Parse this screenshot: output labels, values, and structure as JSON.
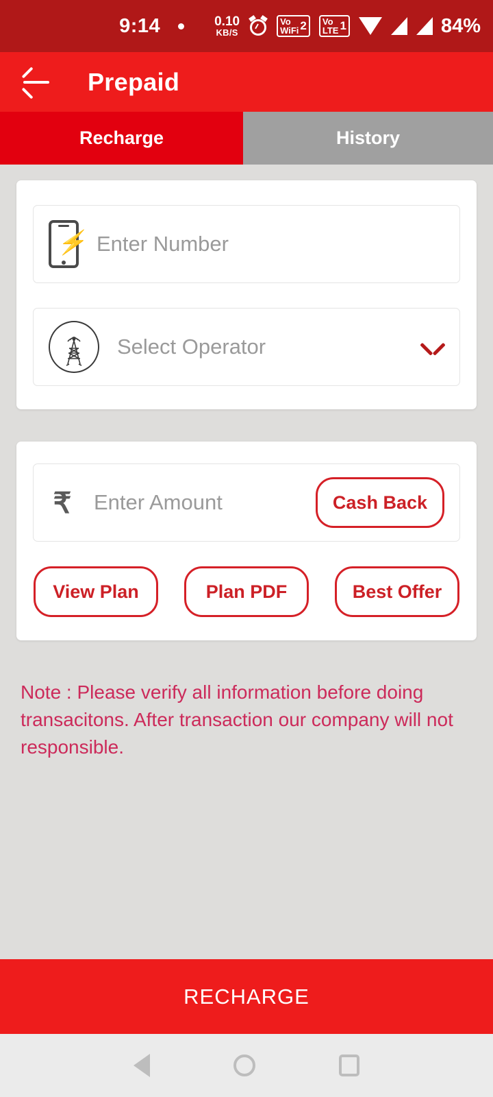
{
  "status_bar": {
    "time": "9:14",
    "net_speed_value": "0.10",
    "net_speed_unit": "KB/S",
    "alarm_icon": "alarm-clock-icon",
    "volte_wifi_label": "Vo",
    "volte_wifi_sub": "WiFi",
    "volte_wifi_sim": "2",
    "volte_label": "Vo",
    "volte_sub": "LTE",
    "volte_sim": "1",
    "wifi_icon": "wifi-icon",
    "signal_icon": "signal-bars-icon",
    "battery": "84%"
  },
  "app_bar": {
    "back_icon": "back-arrow-icon",
    "title": "Prepaid"
  },
  "tabs": [
    {
      "label": "Recharge",
      "active": true
    },
    {
      "label": "History",
      "active": false
    }
  ],
  "recharge_form": {
    "number_field": {
      "icon": "mobile-recharge-icon",
      "value": "",
      "placeholder": "Enter Number"
    },
    "operator_field": {
      "icon": "cell-tower-icon",
      "value": "",
      "placeholder": "Select Operator",
      "dropdown_icon": "chevron-down-icon"
    },
    "amount_field": {
      "icon": "rupee-icon",
      "currency_symbol": "₹",
      "value": "",
      "placeholder": "Enter Amount"
    },
    "cash_back_label": "Cash Back",
    "actions": [
      {
        "label": "View Plan"
      },
      {
        "label": "Plan PDF"
      },
      {
        "label": "Best Offer"
      }
    ]
  },
  "note": "Note : Please verify all information before doing transacitons. After transaction our company will not responsible.",
  "submit": {
    "label": "RECHARGE"
  },
  "nav_bar": {
    "back_icon": "nav-back-icon",
    "home_icon": "nav-home-icon",
    "recent_icon": "nav-recent-icon"
  },
  "colors": {
    "status_bar_red": "#b01818",
    "app_bar_red": "#ee1c1c",
    "tab_active_red": "#e2000f",
    "tab_inactive_gray": "#a0a0a0",
    "outline_red": "#d52027",
    "note_pink": "#cc2a5a",
    "page_background": "#dedddb"
  }
}
